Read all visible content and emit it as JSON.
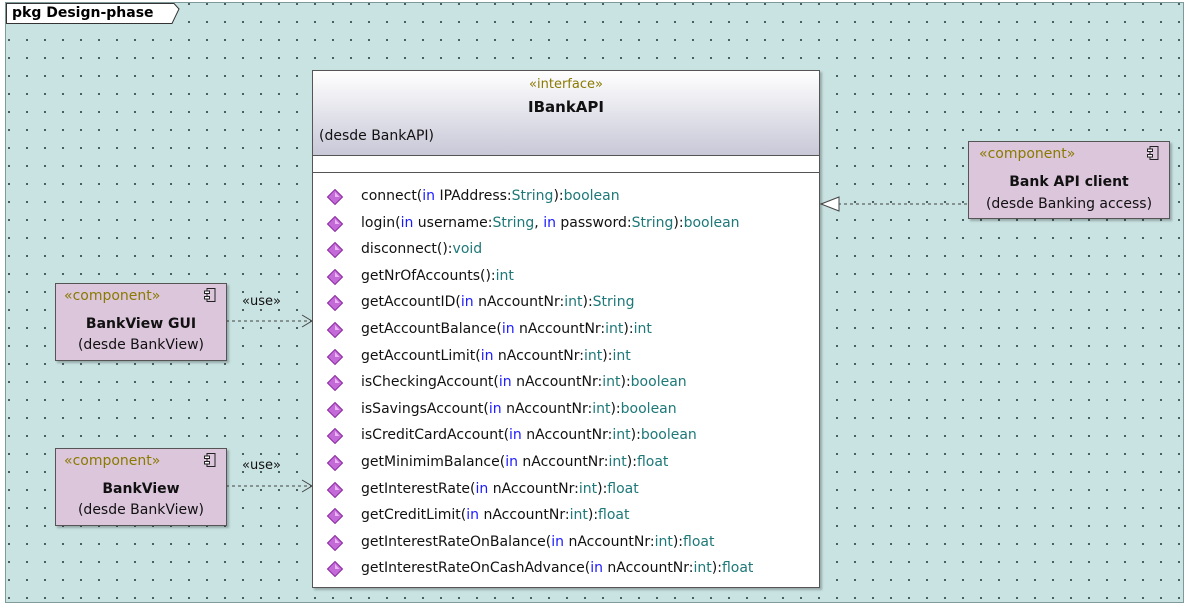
{
  "package": {
    "label": "pkg Design-phase"
  },
  "interface": {
    "stereotype": "«interface»",
    "name": "IBankAPI",
    "origin": "(desde BankAPI)",
    "operations": [
      [
        {
          "t": "connect(",
          "c": "n"
        },
        {
          "t": "in",
          "c": "k"
        },
        {
          "t": " IPAddress:",
          "c": "n"
        },
        {
          "t": "String",
          "c": "t"
        },
        {
          "t": "):",
          "c": "n"
        },
        {
          "t": "boolean",
          "c": "t"
        }
      ],
      [
        {
          "t": "login(",
          "c": "n"
        },
        {
          "t": "in",
          "c": "k"
        },
        {
          "t": " username:",
          "c": "n"
        },
        {
          "t": "String",
          "c": "t"
        },
        {
          "t": ", ",
          "c": "n"
        },
        {
          "t": "in",
          "c": "k"
        },
        {
          "t": " password:",
          "c": "n"
        },
        {
          "t": "String",
          "c": "t"
        },
        {
          "t": "):",
          "c": "n"
        },
        {
          "t": "boolean",
          "c": "t"
        }
      ],
      [
        {
          "t": "disconnect():",
          "c": "n"
        },
        {
          "t": "void",
          "c": "t"
        }
      ],
      [
        {
          "t": "getNrOfAccounts():",
          "c": "n"
        },
        {
          "t": "int",
          "c": "t"
        }
      ],
      [
        {
          "t": "getAccountID(",
          "c": "n"
        },
        {
          "t": "in",
          "c": "k"
        },
        {
          "t": " nAccountNr:",
          "c": "n"
        },
        {
          "t": "int",
          "c": "t"
        },
        {
          "t": "):",
          "c": "n"
        },
        {
          "t": "String",
          "c": "t"
        }
      ],
      [
        {
          "t": "getAccountBalance(",
          "c": "n"
        },
        {
          "t": "in",
          "c": "k"
        },
        {
          "t": " nAccountNr:",
          "c": "n"
        },
        {
          "t": "int",
          "c": "t"
        },
        {
          "t": "):",
          "c": "n"
        },
        {
          "t": "int",
          "c": "t"
        }
      ],
      [
        {
          "t": "getAccountLimit(",
          "c": "n"
        },
        {
          "t": "in",
          "c": "k"
        },
        {
          "t": " nAccountNr:",
          "c": "n"
        },
        {
          "t": "int",
          "c": "t"
        },
        {
          "t": "):",
          "c": "n"
        },
        {
          "t": "int",
          "c": "t"
        }
      ],
      [
        {
          "t": "isCheckingAccount(",
          "c": "n"
        },
        {
          "t": "in",
          "c": "k"
        },
        {
          "t": " nAccountNr:",
          "c": "n"
        },
        {
          "t": "int",
          "c": "t"
        },
        {
          "t": "):",
          "c": "n"
        },
        {
          "t": "boolean",
          "c": "t"
        }
      ],
      [
        {
          "t": "isSavingsAccount(",
          "c": "n"
        },
        {
          "t": "in",
          "c": "k"
        },
        {
          "t": " nAccountNr:",
          "c": "n"
        },
        {
          "t": "int",
          "c": "t"
        },
        {
          "t": "):",
          "c": "n"
        },
        {
          "t": "boolean",
          "c": "t"
        }
      ],
      [
        {
          "t": "isCreditCardAccount(",
          "c": "n"
        },
        {
          "t": "in",
          "c": "k"
        },
        {
          "t": " nAccountNr:",
          "c": "n"
        },
        {
          "t": "int",
          "c": "t"
        },
        {
          "t": "):",
          "c": "n"
        },
        {
          "t": "boolean",
          "c": "t"
        }
      ],
      [
        {
          "t": "getMinimimBalance(",
          "c": "n"
        },
        {
          "t": "in",
          "c": "k"
        },
        {
          "t": " nAccountNr:",
          "c": "n"
        },
        {
          "t": "int",
          "c": "t"
        },
        {
          "t": "):",
          "c": "n"
        },
        {
          "t": "float",
          "c": "t"
        }
      ],
      [
        {
          "t": "getInterestRate(",
          "c": "n"
        },
        {
          "t": "in",
          "c": "k"
        },
        {
          "t": " nAccountNr:",
          "c": "n"
        },
        {
          "t": "int",
          "c": "t"
        },
        {
          "t": "):",
          "c": "n"
        },
        {
          "t": "float",
          "c": "t"
        }
      ],
      [
        {
          "t": "getCreditLimit(",
          "c": "n"
        },
        {
          "t": "in",
          "c": "k"
        },
        {
          "t": " nAccountNr:",
          "c": "n"
        },
        {
          "t": "int",
          "c": "t"
        },
        {
          "t": "):",
          "c": "n"
        },
        {
          "t": "float",
          "c": "t"
        }
      ],
      [
        {
          "t": "getInterestRateOnBalance(",
          "c": "n"
        },
        {
          "t": "in",
          "c": "k"
        },
        {
          "t": " nAccountNr:",
          "c": "n"
        },
        {
          "t": "int",
          "c": "t"
        },
        {
          "t": "):",
          "c": "n"
        },
        {
          "t": "float",
          "c": "t"
        }
      ],
      [
        {
          "t": "getInterestRateOnCashAdvance(",
          "c": "n"
        },
        {
          "t": "in",
          "c": "k"
        },
        {
          "t": " nAccountNr:",
          "c": "n"
        },
        {
          "t": "int",
          "c": "t"
        },
        {
          "t": "):",
          "c": "n"
        },
        {
          "t": "float",
          "c": "t"
        }
      ]
    ]
  },
  "components": {
    "api_client": {
      "stereotype": "«component»",
      "name": "Bank API client",
      "origin": "(desde Banking access)"
    },
    "bankview_gui": {
      "stereotype": "«component»",
      "name": "BankView GUI",
      "origin": "(desde BankView)"
    },
    "bankview": {
      "stereotype": "«component»",
      "name": "BankView",
      "origin": "(desde BankView)"
    }
  },
  "relations": {
    "use_label_1": "«use»",
    "use_label_2": "«use»"
  },
  "colors": {
    "canvas": "#c9e2e2",
    "component_fill": "#dcc6dc",
    "stereotype": "#8a7a00",
    "keyword": "#1a1aff",
    "type": "#1e7878",
    "operation_icon": "#b04cc8"
  },
  "icons": {
    "operation": "purple-diamond-icon",
    "component": "component-icon"
  }
}
